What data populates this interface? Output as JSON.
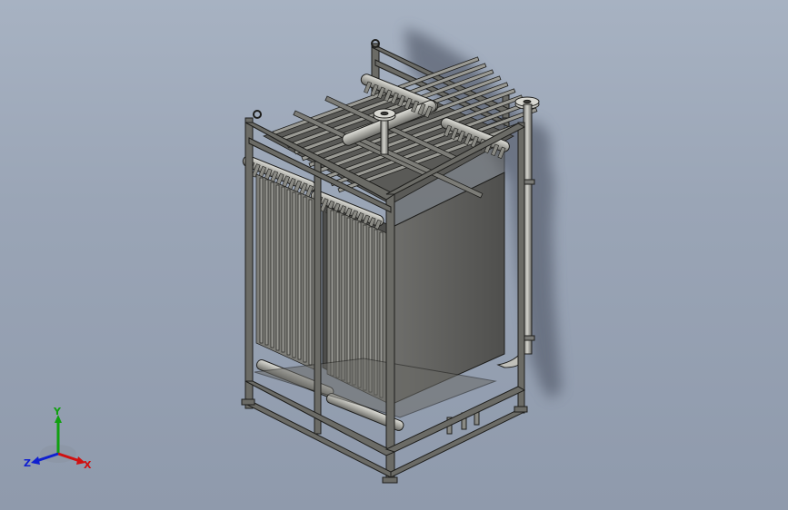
{
  "viewport": {
    "background_top": "#a7b2c2",
    "background_bottom": "#8f9aac"
  },
  "model": {
    "frame_color": "#6b6b66",
    "frame_edge": "#1e1e1c",
    "tank_color": "#5a5a58",
    "membrane_color": "#8a8a84",
    "pipe_color": "#b4b4ae",
    "shadow_color": "#5b6473"
  },
  "triad": {
    "x_label": "X",
    "y_label": "Y",
    "z_label": "Z",
    "x_color": "#d01010",
    "y_color": "#10a010",
    "z_color": "#1020d0"
  }
}
